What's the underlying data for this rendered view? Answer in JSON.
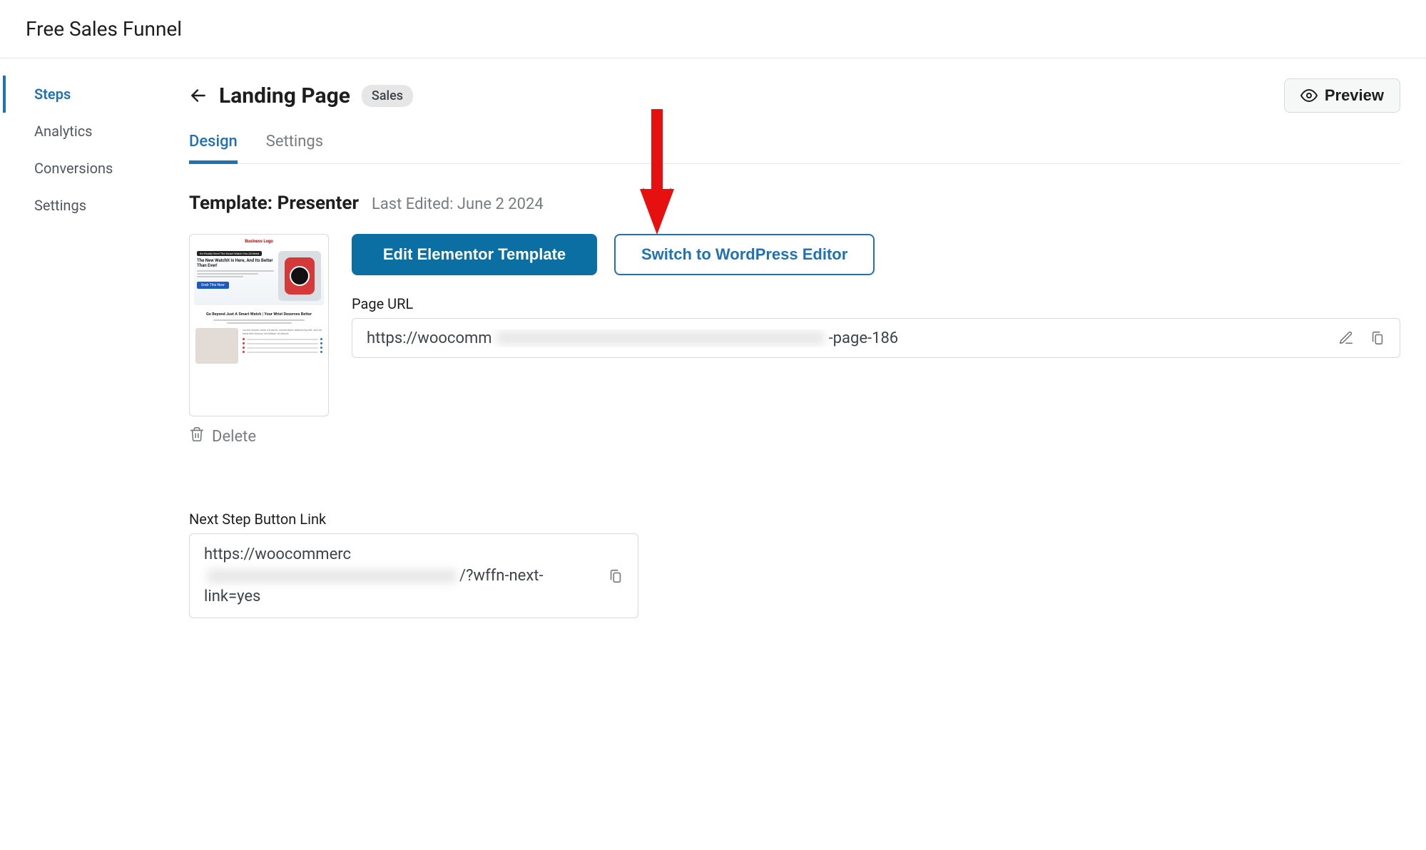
{
  "header": {
    "title": "Free Sales Funnel"
  },
  "sidebar": {
    "items": [
      {
        "label": "Steps",
        "active": true
      },
      {
        "label": "Analytics",
        "active": false
      },
      {
        "label": "Conversions",
        "active": false
      },
      {
        "label": "Settings",
        "active": false
      }
    ]
  },
  "page": {
    "title": "Landing Page",
    "type_badge": "Sales",
    "preview_label": "Preview"
  },
  "tabs": [
    {
      "label": "Design",
      "active": true
    },
    {
      "label": "Settings",
      "active": false
    }
  ],
  "template": {
    "label_prefix": "Template: ",
    "name": "Presenter",
    "last_edited_prefix": "Last Edited: ",
    "last_edited_value": "June 2   2024"
  },
  "thumbnail": {
    "logo": "Business Logo",
    "pill": "It's Finally Here! The Smart Watch You All Need",
    "hero_title": "The New WatchIt Is Here, And Its Better Than Ever!",
    "cta": "Grab This Now",
    "subheading": "Go Beyond Just A Smart Watch | Your Wrist Deserves Better",
    "lorem": "Lorem ipsum dolor sit amet, consectetur adipiscing elit, sed do eiusmod tempor incididunt ut labore."
  },
  "actions": {
    "edit_template": "Edit Elementor Template",
    "switch_editor": "Switch to WordPress Editor",
    "delete": "Delete"
  },
  "page_url": {
    "label": "Page URL",
    "prefix": "https://woocomm",
    "suffix": "-page-186"
  },
  "next_step": {
    "label": "Next Step Button Link",
    "url_prefix": "https://woocommerc",
    "url_suffix": "/?wffn-next-link=yes"
  }
}
